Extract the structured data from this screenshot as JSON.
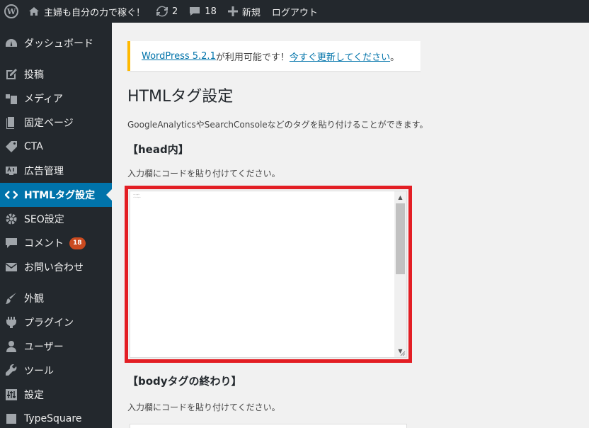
{
  "adminbar": {
    "site_name": "主婦も自分の力で稼ぐ！",
    "updates_count": "2",
    "comments_count": "18",
    "new_label": "新規",
    "logout_label": "ログアウト"
  },
  "sidebar": {
    "items": [
      {
        "label": "ダッシュボード",
        "icon": "dashboard-icon"
      },
      {
        "label": "投稿",
        "icon": "pin-icon"
      },
      {
        "label": "メディア",
        "icon": "media-icon"
      },
      {
        "label": "固定ページ",
        "icon": "page-icon"
      },
      {
        "label": "CTA",
        "icon": "tag-icon"
      },
      {
        "label": "広告管理",
        "icon": "ad-icon"
      },
      {
        "label": "HTMLタグ設定",
        "icon": "code-icon",
        "active": true
      },
      {
        "label": "SEO設定",
        "icon": "gear-icon"
      },
      {
        "label": "コメント",
        "icon": "comment-icon",
        "badge": "18"
      },
      {
        "label": "お問い合わせ",
        "icon": "mail-icon"
      },
      {
        "label": "外観",
        "icon": "brush-icon"
      },
      {
        "label": "プラグイン",
        "icon": "plugin-icon"
      },
      {
        "label": "ユーザー",
        "icon": "user-icon"
      },
      {
        "label": "ツール",
        "icon": "wrench-icon"
      },
      {
        "label": "設定",
        "icon": "settings-icon"
      },
      {
        "label": "TypeSquare",
        "icon": "typesquare-icon"
      }
    ]
  },
  "notice": {
    "link1": "WordPress 5.2.1",
    "text": " が利用可能です！",
    "link2": "今すぐ更新してください",
    "end": "。"
  },
  "page": {
    "title": "HTMLタグ設定",
    "description": "GoogleAnalyticsやSearchConsoleなどのタグを貼り付けることができます。"
  },
  "head_section": {
    "heading": "【head内】",
    "help": "入力欄にコードを貼り付けてください。"
  },
  "body_section": {
    "heading": "【bodyタグの終わり】",
    "help": "入力欄にコードを貼り付けてください。"
  },
  "colors": {
    "adminbar_bg": "#23282d",
    "active_menu": "#0073aa",
    "highlight": "#e31e24",
    "notice_border": "#ffb900",
    "badge": "#ca4a1f"
  }
}
